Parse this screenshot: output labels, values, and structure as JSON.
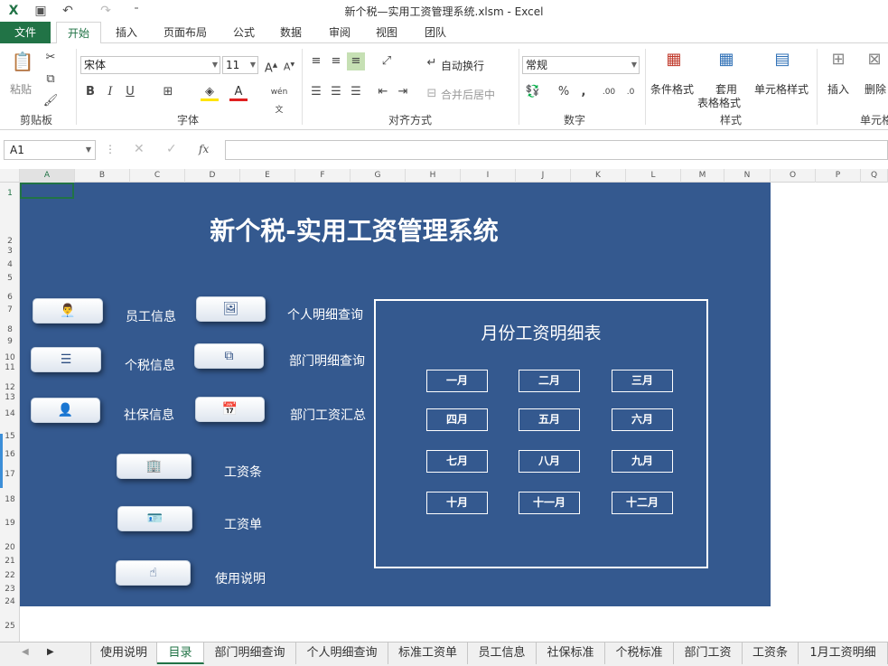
{
  "window": {
    "title": "新个税—实用工资管理系统.xlsm - Excel"
  },
  "ribbon_tabs": [
    "文件",
    "开始",
    "插入",
    "页面布局",
    "公式",
    "数据",
    "审阅",
    "视图",
    "团队"
  ],
  "ribbon": {
    "paste": "粘贴",
    "clipboard": "剪贴板",
    "font_name": "宋体",
    "font_size": "11",
    "font_group": "字体",
    "wrap_text": "自动换行",
    "merge_center": "合并后居中",
    "align_group": "对齐方式",
    "number_format": "常规",
    "number_group": "数字",
    "cond_format": "条件格式",
    "table_format_1": "套用",
    "table_format_2": "表格格式",
    "cell_style": "单元格样式",
    "styles_group": "样式",
    "insert": "插入",
    "delete": "删除",
    "cells_group": "单元格",
    "bold": "B",
    "italic": "I",
    "underline": "U",
    "wen": "wén 文"
  },
  "formula_bar": {
    "cell_ref": "A1",
    "fx": "fx",
    "value": ""
  },
  "columns": [
    "A",
    "B",
    "C",
    "D",
    "E",
    "F",
    "G",
    "H",
    "I",
    "J",
    "K",
    "L",
    "M",
    "N",
    "O",
    "P",
    "Q"
  ],
  "rows": [
    "1",
    "2",
    "3",
    "4",
    "5",
    "6",
    "7",
    "8",
    "9",
    "10",
    "11",
    "12",
    "13",
    "14",
    "15",
    "16",
    "17",
    "18",
    "19",
    "20",
    "21",
    "22",
    "23",
    "24",
    "25"
  ],
  "dashboard": {
    "title": "新个税-实用工资管理系统",
    "nav_left": [
      "员工信息",
      "个税信息",
      "社保信息"
    ],
    "nav_right": [
      "个人明细查询",
      "部门明细查询",
      "部门工资汇总"
    ],
    "nav_center": [
      "工资条",
      "工资单",
      "使用说明"
    ],
    "month_panel_title": "月份工资明细表",
    "months": [
      "一月",
      "二月",
      "三月",
      "四月",
      "五月",
      "六月",
      "七月",
      "八月",
      "九月",
      "十月",
      "十一月",
      "十二月"
    ]
  },
  "sheet_tabs": [
    "使用说明",
    "目录",
    "部门明细查询",
    "个人明细查询",
    "标准工资单",
    "员工信息",
    "社保标准",
    "个税标准",
    "部门工资",
    "工资条",
    "1月工资明细"
  ],
  "active_sheet": "目录",
  "colors": {
    "excel_green": "#217346",
    "panel_blue": "#34598f"
  }
}
